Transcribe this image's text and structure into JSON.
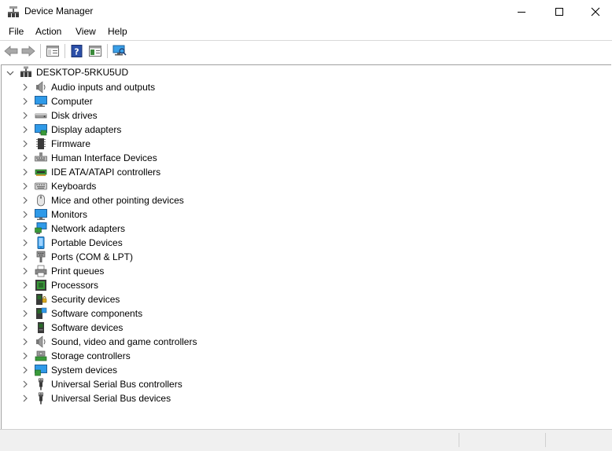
{
  "window": {
    "title": "Device Manager",
    "controls": [
      "minimize",
      "maximize",
      "close"
    ]
  },
  "menu": {
    "file": "File",
    "action": "Action",
    "view": "View",
    "help": "Help"
  },
  "toolbar": {
    "icons": [
      "back-icon",
      "forward-icon",
      "properties-icon",
      "help-icon",
      "update-driver-icon",
      "scan-hardware-icon"
    ]
  },
  "tree": {
    "root": "DESKTOP-5RKU5UD",
    "items": [
      {
        "label": "Audio inputs and outputs",
        "icon": "speaker-icon"
      },
      {
        "label": "Computer",
        "icon": "computer-icon"
      },
      {
        "label": "Disk drives",
        "icon": "disk-drive-icon"
      },
      {
        "label": "Display adapters",
        "icon": "display-adapter-icon"
      },
      {
        "label": "Firmware",
        "icon": "firmware-icon"
      },
      {
        "label": "Human Interface Devices",
        "icon": "hid-icon"
      },
      {
        "label": "IDE ATA/ATAPI controllers",
        "icon": "ide-controller-icon"
      },
      {
        "label": "Keyboards",
        "icon": "keyboard-icon"
      },
      {
        "label": "Mice and other pointing devices",
        "icon": "mouse-icon"
      },
      {
        "label": "Monitors",
        "icon": "monitor-icon"
      },
      {
        "label": "Network adapters",
        "icon": "network-adapter-icon"
      },
      {
        "label": "Portable Devices",
        "icon": "portable-device-icon"
      },
      {
        "label": "Ports (COM & LPT)",
        "icon": "port-icon"
      },
      {
        "label": "Print queues",
        "icon": "printer-icon"
      },
      {
        "label": "Processors",
        "icon": "processor-icon"
      },
      {
        "label": "Security devices",
        "icon": "security-device-icon"
      },
      {
        "label": "Software components",
        "icon": "software-component-icon"
      },
      {
        "label": "Software devices",
        "icon": "software-device-icon"
      },
      {
        "label": "Sound, video and game controllers",
        "icon": "sound-controller-icon"
      },
      {
        "label": "Storage controllers",
        "icon": "storage-controller-icon"
      },
      {
        "label": "System devices",
        "icon": "system-device-icon"
      },
      {
        "label": "Universal Serial Bus controllers",
        "icon": "usb-controller-icon"
      },
      {
        "label": "Universal Serial Bus devices",
        "icon": "usb-device-icon"
      }
    ]
  },
  "colors": {
    "accent": "#0078d7",
    "monitor_blue": "#1e90ff",
    "chevron": "#606060"
  }
}
